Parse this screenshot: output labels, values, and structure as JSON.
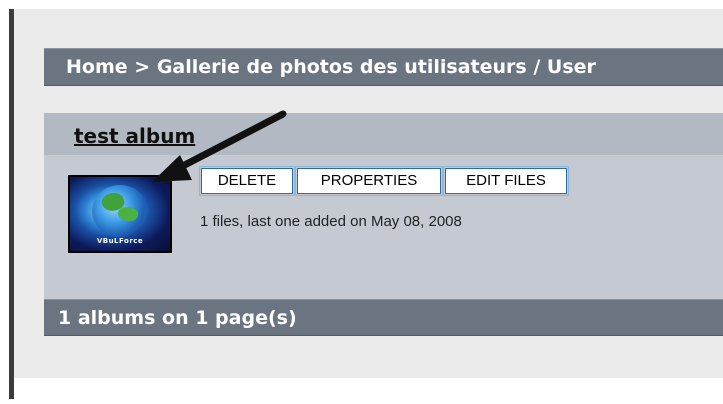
{
  "breadcrumb": {
    "home": "Home",
    "separator": ">",
    "gallery": "Gallerie de photos des utilisateurs / User"
  },
  "album": {
    "title": "test album",
    "buttons": {
      "delete": "DELETE",
      "properties": "PROPERTIES",
      "edit_files": "EDIT FILES"
    },
    "info": "1 files, last one added on May 08, 2008",
    "thumbnail_caption": "VBuLForce"
  },
  "footer": {
    "count": "1 albums on 1 page(s)"
  },
  "colors": {
    "bar": "#6b7582",
    "panel": "#c5cad2",
    "title_row": "#b3b9c2",
    "button_border": "#2a6d9e"
  },
  "icons": {
    "annotation": "arrow-icon"
  }
}
